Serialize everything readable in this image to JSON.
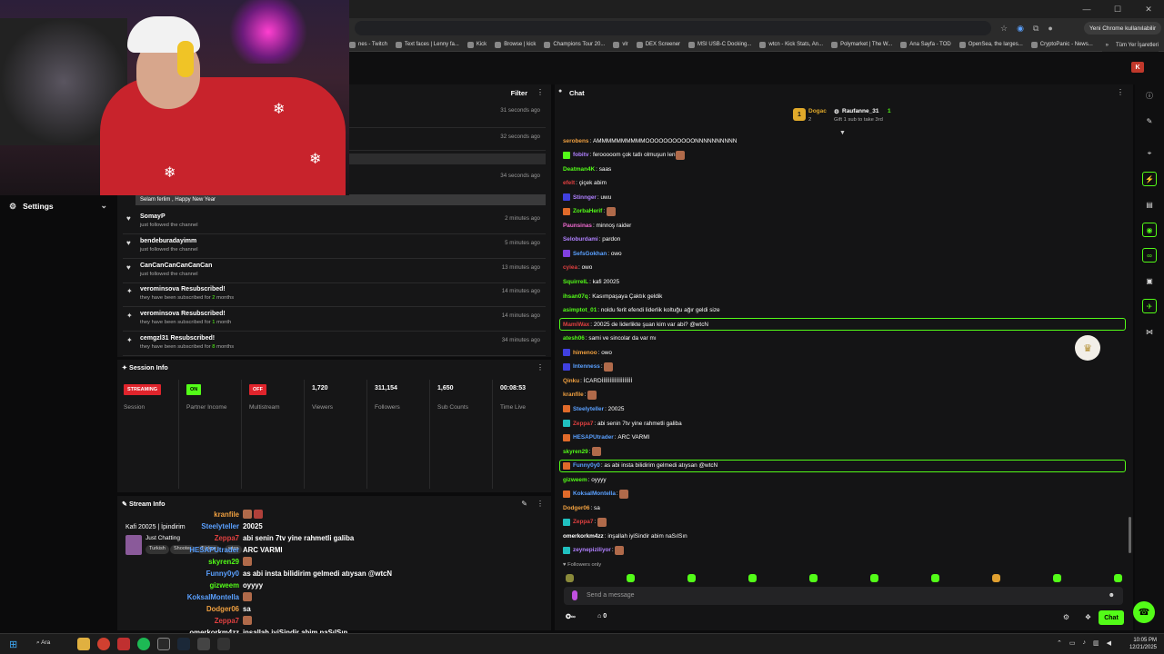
{
  "browser": {
    "chrome_badge": "Yeni Chrome kullanılabilir",
    "all_bookmarks": "Tüm Yer İşaretleri",
    "bookmarks": [
      "nes - Twitch",
      "Text faces | Lenny fa...",
      "Kick",
      "Browse | kick",
      "Champions Tour 20...",
      "vlr",
      "DEX Screener",
      "MSI USB-C Docking...",
      "wtcn - Kick Stats, An...",
      "Polymarket | The W...",
      "Ana Sayfa - TOD",
      "OpenSea, the larges...",
      "CryptoPanic - News..."
    ]
  },
  "sidebar": {
    "settings_label": "Settings"
  },
  "activity": {
    "filter_label": "Filter",
    "times_top": [
      "31 seconds ago",
      "32 seconds ago",
      "34 seconds ago"
    ],
    "message_text": "Selam ferlim , Happy New Year",
    "rows": [
      {
        "name": "SomayP",
        "sub": "just followed the channel",
        "time": "2 minutes ago",
        "icon": "heart"
      },
      {
        "name": "bendeburadayimm",
        "sub": "just followed the channel",
        "time": "5 minutes ago",
        "icon": "heart"
      },
      {
        "name": "CanCanCanCanCanCan",
        "sub": "just followed the channel",
        "time": "13 minutes ago",
        "icon": "heart"
      },
      {
        "name": "verominsova Resubscribed!",
        "sub_pre": "they have been subscribed for ",
        "sub_num": "2",
        "sub_post": " months",
        "time": "14 minutes ago",
        "icon": "star"
      },
      {
        "name": "verominsova Resubscribed!",
        "sub_pre": "they have been subscribed for ",
        "sub_num": "1",
        "sub_post": " month",
        "time": "14 minutes ago",
        "icon": "star"
      },
      {
        "name": "cemgzl31 Resubscribed!",
        "sub_pre": "they have been subscribed for ",
        "sub_num": "8",
        "sub_post": " months",
        "time": "34 minutes ago",
        "icon": "star"
      }
    ]
  },
  "session": {
    "title": "Session Info",
    "cells": [
      {
        "badge": "STREAMING",
        "badge_color": "#e0242c",
        "label": "Session"
      },
      {
        "badge": "ON",
        "badge_color": "#53fc18",
        "label": "Partner Income"
      },
      {
        "badge": "OFF",
        "badge_color": "#e0242c",
        "label": "Multistream"
      },
      {
        "num": "1,720",
        "label": "Viewers"
      },
      {
        "num": "311,154",
        "label": "Followers"
      },
      {
        "num": "1,650",
        "label": "Sub Counts"
      },
      {
        "num": "00:08:53",
        "label": "Time Live"
      }
    ]
  },
  "stream_info": {
    "title": "Stream Info",
    "stream_title": "Kafi 20025 | İpindirim",
    "category": "Just Chatting",
    "tags": [
      "Turkish",
      "Shooter",
      "Türkçe",
      "wtcn"
    ]
  },
  "overlay_chat": [
    {
      "user": "kranfile",
      "color": "#f0a040",
      "msg": "",
      "emotes": 2
    },
    {
      "user": "Steelyteller",
      "color": "#5aa0ff",
      "msg": "20025",
      "emotes": 0
    },
    {
      "user": "Zeppa7",
      "color": "#e04040",
      "msg": "abi senin 7tv yine rahmetli galiba",
      "emotes": 0
    },
    {
      "user": "HESAPUtrader",
      "color": "#5aa0ff",
      "msg": "ARC VARMI",
      "emotes": 0
    },
    {
      "user": "skyren29",
      "color": "#53fc18",
      "msg": "",
      "emotes": 1
    },
    {
      "user": "Funny0y0",
      "color": "#5aa0ff",
      "msg": "as abi insta bilidirim gelmedi atıysan @wtcN",
      "emotes": 0
    },
    {
      "user": "gizweem",
      "color": "#53fc18",
      "msg": "oyyyy",
      "emotes": 0
    },
    {
      "user": "KoksalMontella",
      "color": "#5aa0ff",
      "msg": "",
      "emotes": 1
    },
    {
      "user": "Dodger06",
      "color": "#f0a040",
      "msg": "sa",
      "emotes": 0
    },
    {
      "user": "Zeppa7",
      "color": "#e04040",
      "msg": "",
      "emotes": 1
    },
    {
      "user": "omerkorkm4zz",
      "color": "#ffffff",
      "msg": "inşallah iyiSindir abim naSılSın",
      "emotes": 0
    },
    {
      "user": "zeynepiziliyor",
      "color": "#b080ff",
      "msg": "",
      "emotes": 1
    }
  ],
  "chat": {
    "title": "Chat",
    "leaderboard": {
      "first_name": "Dogac",
      "first_count": "2",
      "rank": "1",
      "second_name": "Raufanne_31",
      "second_count": "1",
      "gift_text": "Gift 1 sub to take 3rd"
    },
    "messages": [
      {
        "user": "serobens",
        "color": "#f0a040",
        "msg": "AMMMMMMMMMMOOOOOOOOOOONNNNNNNNNN",
        "badge": ""
      },
      {
        "user": "fobitv",
        "color": "#b080ff",
        "msg": "ferooooom çok tatlı olmuşun len",
        "badge": "#53fc18",
        "emote": true
      },
      {
        "user": "Deatman4K",
        "color": "#53fc18",
        "msg": "saas",
        "badge": ""
      },
      {
        "user": "efelt",
        "color": "#e04040",
        "msg": "çiçek abim",
        "badge": ""
      },
      {
        "user": "Stinnger",
        "color": "#b080ff",
        "msg": "uwu",
        "badge": "#4040e0"
      },
      {
        "user": "ZorbaHerif",
        "color": "#53fc18",
        "msg": "",
        "badge": "#e06a2a",
        "emote": true
      },
      {
        "user": "Paunsinas",
        "color": "#f06ad0",
        "msg": "minnoş raider",
        "badge": ""
      },
      {
        "user": "Seloburdami",
        "color": "#b080ff",
        "msg": "pardon",
        "badge": ""
      },
      {
        "user": "SefsGokhan",
        "color": "#5aa0ff",
        "msg": "owo",
        "badge": "#8040e0"
      },
      {
        "user": "cyiea",
        "color": "#e04040",
        "msg": "owo",
        "badge": ""
      },
      {
        "user": "SquirrelL",
        "color": "#53fc18",
        "msg": "kafi 20025",
        "badge": ""
      },
      {
        "user": "ihsan07q",
        "color": "#53fc18",
        "msg": "Kasımpaşaya Çaktık geldik",
        "badge": ""
      },
      {
        "user": "asimptot_01",
        "color": "#53fc18",
        "msg": "noldu ferit efendi liderlik koltuğu ağır geldi size",
        "badge": ""
      },
      {
        "user": "MamiWax",
        "color": "#e04040",
        "msg": "20025 de liderlikte şuan kim var abi? @wtcN",
        "badge": "",
        "hl": true
      },
      {
        "user": "atesh06",
        "color": "#53fc18",
        "msg": "sami ve sincolar da var mı",
        "badge": ""
      },
      {
        "user": "himenoo",
        "color": "#f0a040",
        "msg": "owo",
        "badge": "#4040e0"
      },
      {
        "user": "Intenness",
        "color": "#5aa0ff",
        "msg": "",
        "badge": "#4040e0",
        "emote": true
      },
      {
        "user": "Qinku",
        "color": "#f0a040",
        "msg": "İCARDİİİİİİİİİİİİİİİİİİİ",
        "badge": ""
      },
      {
        "user": "kranfile",
        "color": "#f0a040",
        "msg": "",
        "badge": "",
        "emote": true
      },
      {
        "user": "Steelyteller",
        "color": "#5aa0ff",
        "msg": "20025",
        "badge": "#e06a2a"
      },
      {
        "user": "Zeppa7",
        "color": "#e04040",
        "msg": "abi senin 7tv yine rahmetli galiba",
        "badge": "#20c0c0"
      },
      {
        "user": "HESAPUtrader",
        "color": "#5aa0ff",
        "msg": "ARC VARMI",
        "badge": "#e06a2a"
      },
      {
        "user": "skyren29",
        "color": "#53fc18",
        "msg": "",
        "badge": "",
        "emote": true
      },
      {
        "user": "Funny0y0",
        "color": "#5aa0ff",
        "msg": "as abi insta bilidirim gelmedi atıysan @wtcN",
        "badge": "#e06a2a",
        "hl": true
      },
      {
        "user": "gizweem",
        "color": "#53fc18",
        "msg": "oyyyy",
        "badge": ""
      },
      {
        "user": "KoksalMontella",
        "color": "#5aa0ff",
        "msg": "",
        "badge": "#e06a2a",
        "emote": true
      },
      {
        "user": "Dodger06",
        "color": "#f0a040",
        "msg": "sa",
        "badge": ""
      },
      {
        "user": "Zeppa7",
        "color": "#e04040",
        "msg": "",
        "badge": "#20c0c0",
        "emote": true
      },
      {
        "user": "omerkorkm4zz",
        "color": "#ffffff",
        "msg": "inşallah iyiSindir abim naSılSın",
        "badge": ""
      },
      {
        "user": "zeynepiziliyor",
        "color": "#b080ff",
        "msg": "",
        "badge": "#20c0c0",
        "emote": true
      }
    ],
    "followers_only": "Followers only",
    "placeholder": "Send a message",
    "points_count": "∞",
    "gift_count": "0",
    "send_label": "Chat"
  },
  "taskbar": {
    "search_label": "Ara",
    "time": "10:05 PM",
    "date": "12/21/2025"
  },
  "colors": {
    "accent": "#53fc18",
    "panel": "#161617",
    "bg": "#0b0b0c"
  }
}
